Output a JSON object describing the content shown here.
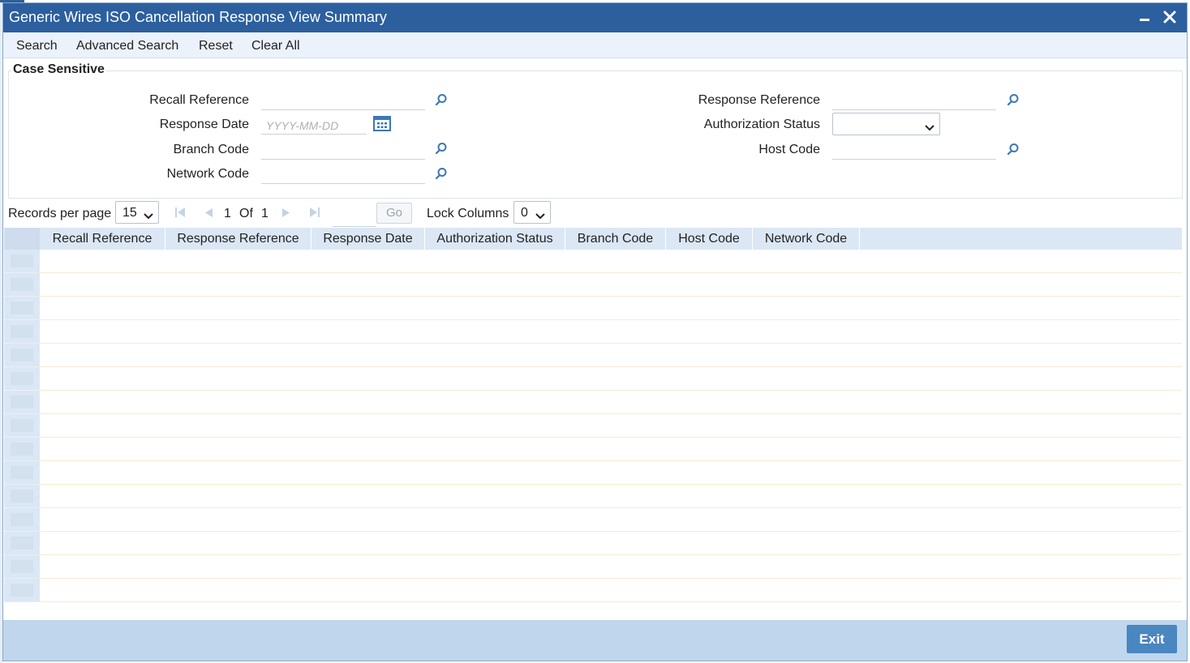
{
  "window": {
    "title": "Generic Wires ISO Cancellation Response View Summary"
  },
  "toolbar": {
    "items": [
      "Search",
      "Advanced Search",
      "Reset",
      "Clear All"
    ]
  },
  "search_panel": {
    "legend": "Case Sensitive",
    "fields": {
      "recall_reference": {
        "label": "Recall Reference",
        "value": ""
      },
      "response_date": {
        "label": "Response Date",
        "value": "",
        "placeholder": "YYYY-MM-DD"
      },
      "branch_code": {
        "label": "Branch Code",
        "value": ""
      },
      "network_code": {
        "label": "Network Code",
        "value": ""
      },
      "response_reference": {
        "label": "Response Reference",
        "value": ""
      },
      "authorization_status": {
        "label": "Authorization Status",
        "value": ""
      },
      "host_code": {
        "label": "Host Code",
        "value": ""
      }
    }
  },
  "pager": {
    "records_per_page_label": "Records per page",
    "records_per_page": "15",
    "current_page": "1",
    "of_label": "Of",
    "total_pages": "1",
    "go_label": "Go",
    "lock_columns_label": "Lock Columns",
    "lock_columns": "0"
  },
  "grid": {
    "columns": [
      "Recall Reference",
      "Response Reference",
      "Response Date",
      "Authorization Status",
      "Branch Code",
      "Host Code",
      "Network Code"
    ],
    "empty_rows": 15
  },
  "footer": {
    "exit_label": "Exit"
  },
  "colors": {
    "titlebar": "#2c5f9e",
    "toolbar": "#ebf2fb",
    "grid_header": "#dbe7f4",
    "footer": "#bfd6ec",
    "exit_button": "#4a86c0"
  },
  "icons": [
    "minimize-icon",
    "close-icon",
    "search-lookup-icon",
    "calendar-icon",
    "chevron-down-icon",
    "first-page-icon",
    "previous-page-icon",
    "next-page-icon",
    "last-page-icon"
  ]
}
